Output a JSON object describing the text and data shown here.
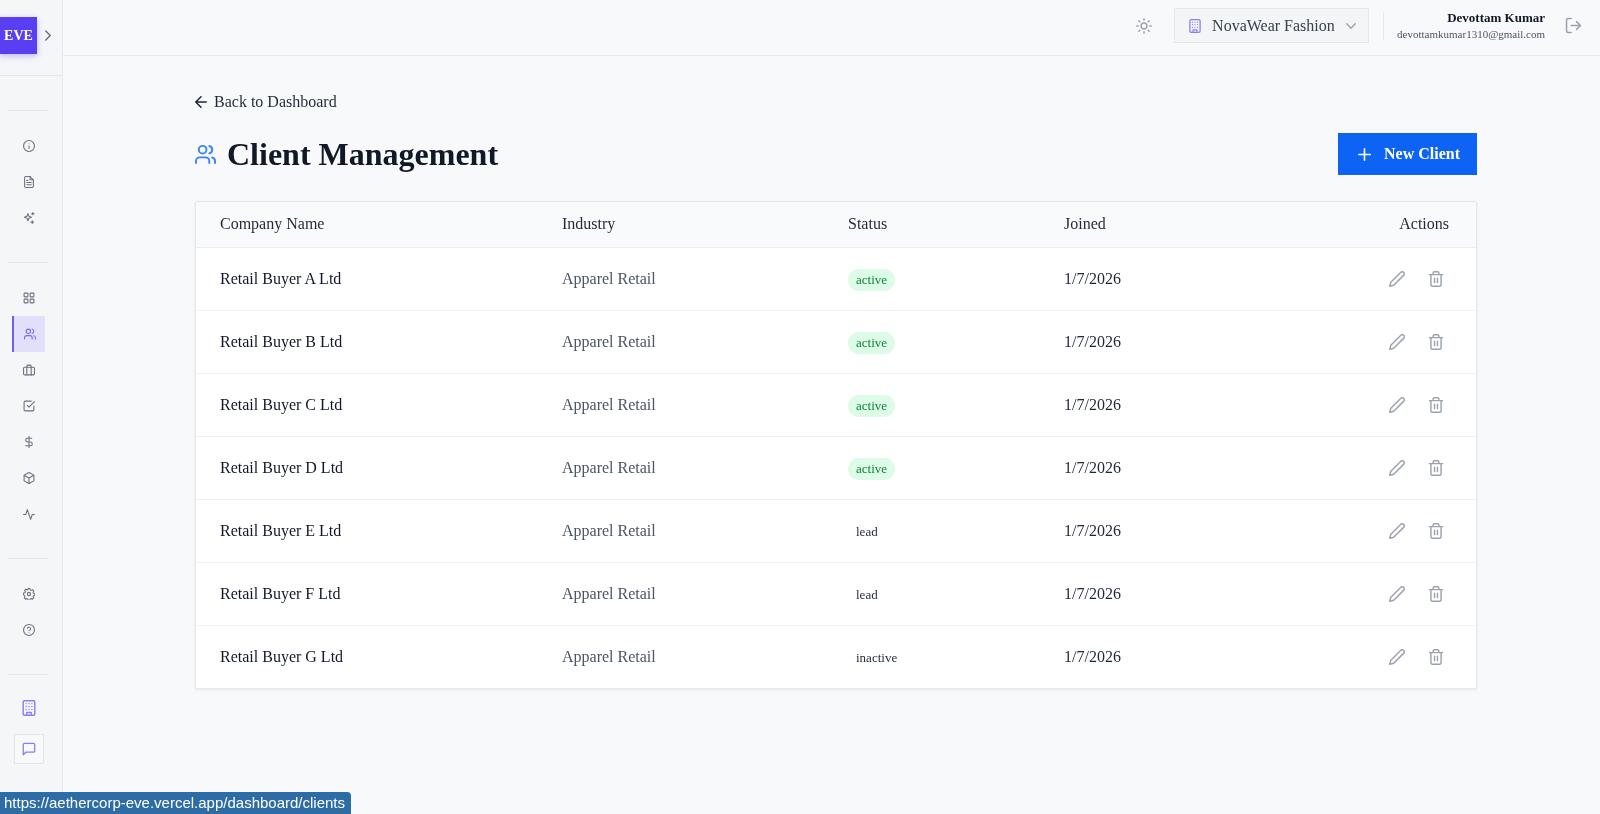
{
  "sidebar": {
    "logo": "EVE",
    "sections": [
      {
        "items": [
          {
            "selected": false
          },
          {
            "selected": false
          },
          {
            "selected": false
          }
        ]
      },
      {
        "items": [
          {
            "selected": false
          },
          {
            "selected": true
          },
          {
            "selected": false
          },
          {
            "selected": false
          },
          {
            "selected": false
          },
          {
            "selected": false
          },
          {
            "selected": false
          }
        ]
      },
      {
        "items": [
          {
            "selected": false
          },
          {
            "selected": false
          }
        ]
      }
    ]
  },
  "topbar": {
    "organization": "NovaWear Fashion",
    "user": {
      "name": "Devottam Kumar",
      "email": "devottamkumar1310@gmail.com"
    }
  },
  "page": {
    "back_link": "Back to Dashboard",
    "title": "Client Management",
    "new_button": "New Client"
  },
  "table": {
    "columns": [
      "Company Name",
      "Industry",
      "Status",
      "Joined",
      "Actions"
    ],
    "rows": [
      {
        "company": "Retail Buyer A Ltd",
        "industry": "Apparel Retail",
        "status": {
          "label": "active",
          "kind": "pill"
        },
        "joined": "1/7/2026"
      },
      {
        "company": "Retail Buyer B Ltd",
        "industry": "Apparel Retail",
        "status": {
          "label": "active",
          "kind": "pill"
        },
        "joined": "1/7/2026"
      },
      {
        "company": "Retail Buyer C Ltd",
        "industry": "Apparel Retail",
        "status": {
          "label": "active",
          "kind": "pill"
        },
        "joined": "1/7/2026"
      },
      {
        "company": "Retail Buyer D Ltd",
        "industry": "Apparel Retail",
        "status": {
          "label": "active",
          "kind": "pill"
        },
        "joined": "1/7/2026"
      },
      {
        "company": "Retail Buyer E Ltd",
        "industry": "Apparel Retail",
        "status": {
          "label": "lead",
          "kind": "plain"
        },
        "joined": "1/7/2026"
      },
      {
        "company": "Retail Buyer F Ltd",
        "industry": "Apparel Retail",
        "status": {
          "label": "lead",
          "kind": "plain"
        },
        "joined": "1/7/2026"
      },
      {
        "company": "Retail Buyer G Ltd",
        "industry": "Apparel Retail",
        "status": {
          "label": "inactive",
          "kind": "plain"
        },
        "joined": "1/7/2026"
      }
    ]
  },
  "status_url": "https://aethercorp-eve.vercel.app/dashboard/clients"
}
